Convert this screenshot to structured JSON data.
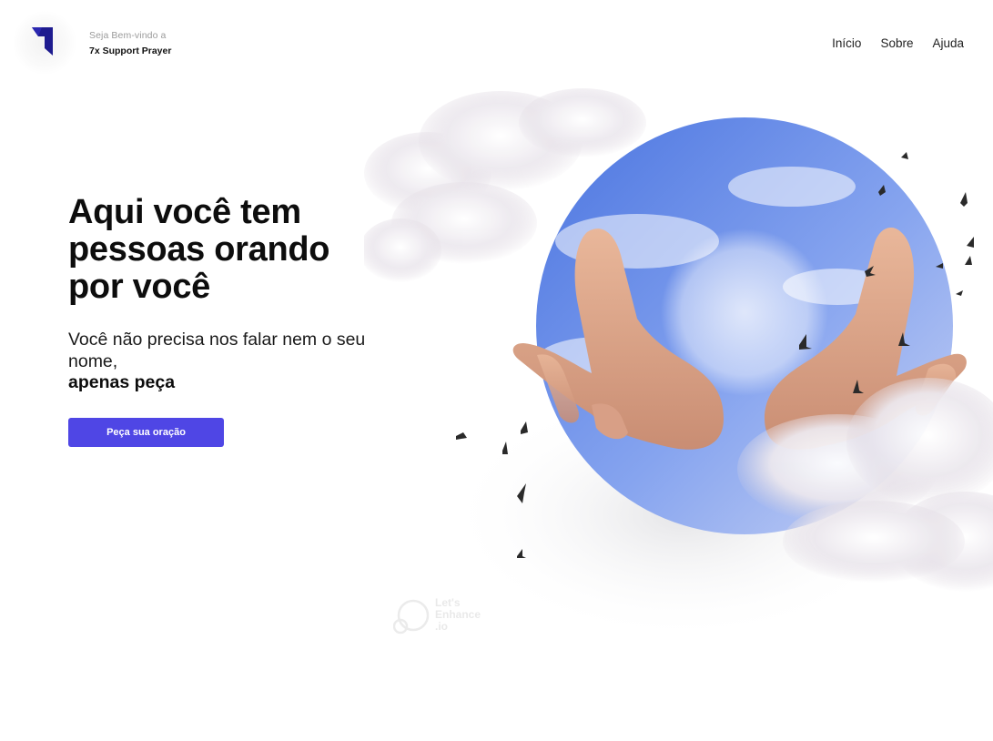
{
  "header": {
    "welcome_text": "Seja Bem-vindo a",
    "brand_name": "7x Support Prayer",
    "logo_icon": "arrow-logo-icon",
    "nav": [
      {
        "label": "Início"
      },
      {
        "label": "Sobre"
      },
      {
        "label": "Ajuda"
      }
    ]
  },
  "hero": {
    "title": "Aqui você tem pessoas orando por você",
    "subtitle": "Você não precisa nos falar nem o seu nome,",
    "subtitle_emphasis": "apenas peça",
    "cta_label": "Peça sua oração"
  },
  "illustration": {
    "description_icon": "praying-hands-sky-circle-icon",
    "watermark_text": [
      "Let's",
      "Enhance",
      ".io"
    ]
  },
  "colors": {
    "accent": "#4f46e5",
    "logo": "#1e1b8f",
    "sky": "#6f93e8"
  }
}
